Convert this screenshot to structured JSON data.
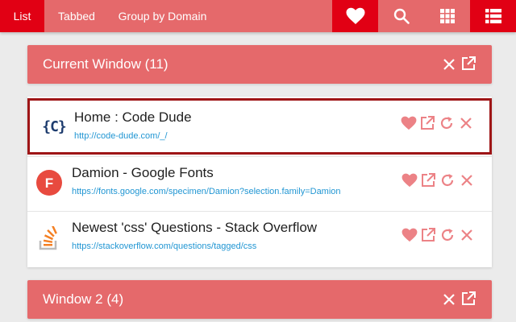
{
  "colors": {
    "accent": "#e10014",
    "primary": "#e5696b",
    "icon_muted": "#ec8286",
    "url": "#2196d3",
    "selected_border": "#9e1516"
  },
  "nav": {
    "tabs": [
      {
        "label": "List",
        "active": true
      },
      {
        "label": "Tabbed",
        "active": false
      },
      {
        "label": "Group by Domain",
        "active": false
      }
    ],
    "icons": [
      "heart-icon",
      "search-icon",
      "grid-icon",
      "list-icon"
    ]
  },
  "windows": [
    {
      "title": "Current Window (11)",
      "tabs": [
        {
          "title": "Home : Code Dude",
          "url": "http://code-dude.com/_/",
          "favicon": "code-dude-favicon",
          "favicon_text": "{C}",
          "selected": true
        },
        {
          "title": "Damion - Google Fonts",
          "url": "https://fonts.google.com/specimen/Damion?selection.family=Damion",
          "favicon": "google-fonts-favicon",
          "favicon_text": "F",
          "selected": false
        },
        {
          "title": "Newest 'css' Questions - Stack Overflow",
          "url": "https://stackoverflow.com/questions/tagged/css",
          "favicon": "stackoverflow-favicon",
          "selected": false
        }
      ]
    },
    {
      "title": "Window 2 (4)"
    }
  ]
}
